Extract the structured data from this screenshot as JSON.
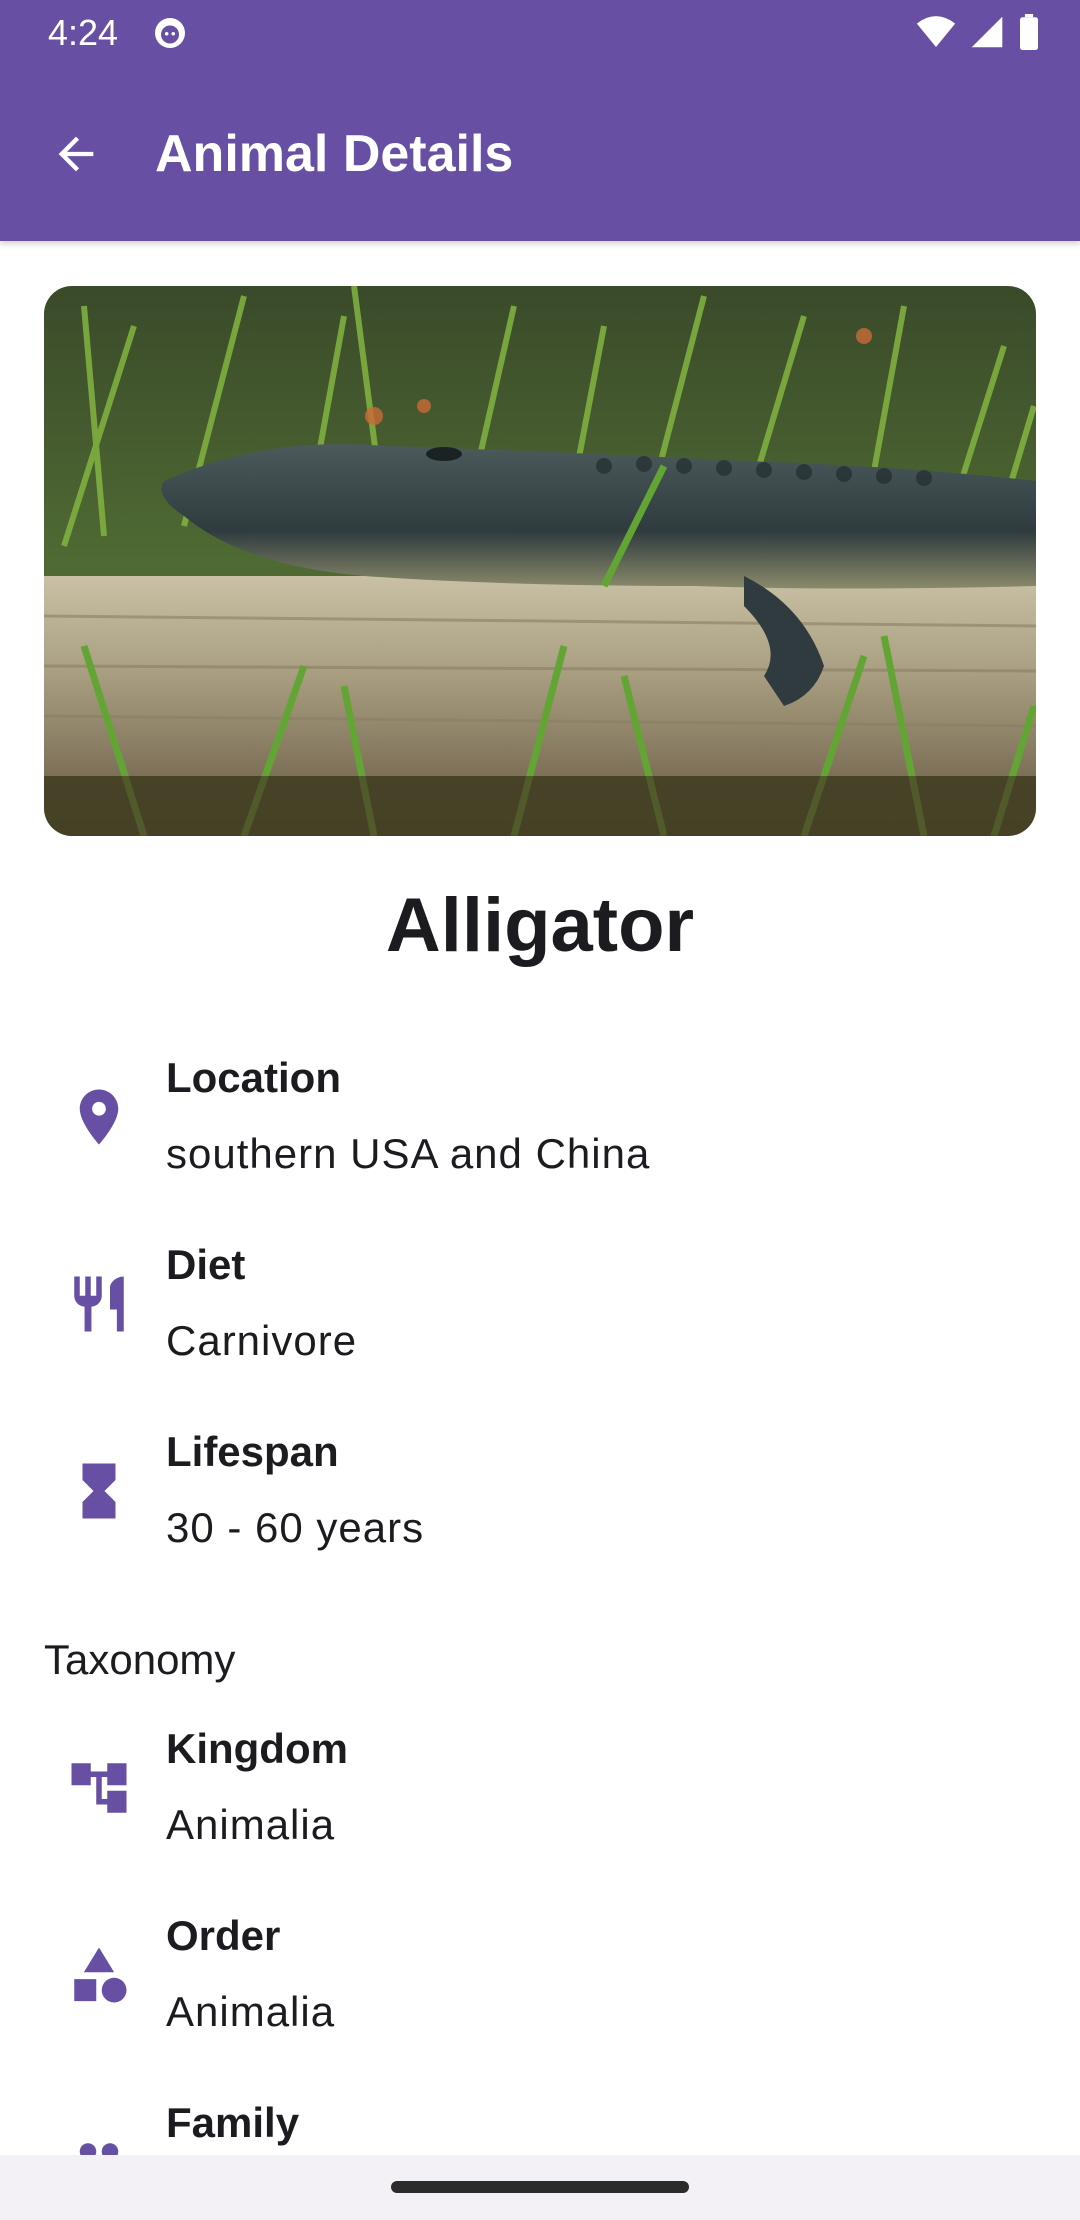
{
  "status_bar": {
    "time": "4:24"
  },
  "app_bar": {
    "title": "Animal Details"
  },
  "animal": {
    "name": "Alligator"
  },
  "details": [
    {
      "label": "Location",
      "value": "southern USA and China",
      "icon": "location-pin-icon"
    },
    {
      "label": "Diet",
      "value": "Carnivore",
      "icon": "restaurant-icon"
    },
    {
      "label": "Lifespan",
      "value": "30 - 60 years",
      "icon": "hourglass-icon"
    }
  ],
  "taxonomy": {
    "title": "Taxonomy",
    "items": [
      {
        "label": "Kingdom",
        "value": "Animalia",
        "icon": "hierarchy-icon"
      },
      {
        "label": "Order",
        "value": "Animalia",
        "icon": "shapes-icon"
      },
      {
        "label": "Family",
        "value": "",
        "icon": "family-icon"
      }
    ]
  },
  "colors": {
    "primary": "#674FA3",
    "text": "#1C1B1F"
  }
}
